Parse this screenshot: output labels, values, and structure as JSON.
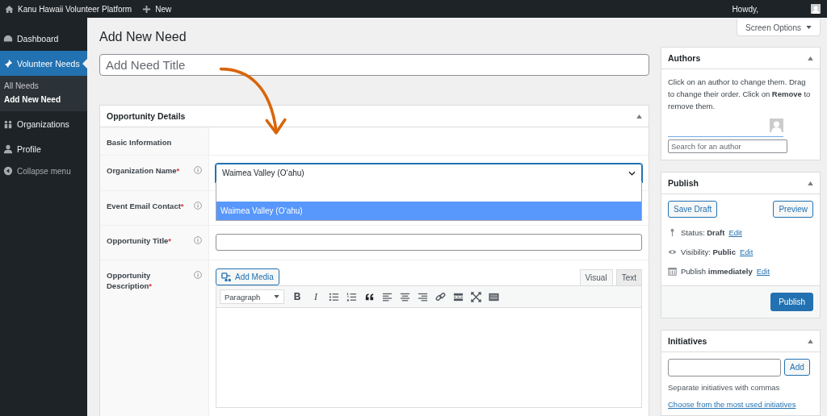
{
  "admin_bar": {
    "site_name": "Kanu Hawaii Volunteer Platform",
    "new_label": "New",
    "greeting": "Howdy,"
  },
  "sidebar": {
    "items": [
      {
        "label": "Dashboard",
        "selected": false
      },
      {
        "label": "Volunteer Needs",
        "selected": true,
        "children": [
          {
            "label": "All Needs",
            "selected": false
          },
          {
            "label": "Add New Need",
            "selected": true
          }
        ]
      },
      {
        "label": "Organizations",
        "selected": false
      },
      {
        "label": "Profile",
        "selected": false
      },
      {
        "label": "Collapse menu",
        "kind": "toggle",
        "selected": false
      }
    ]
  },
  "required_mark": "*",
  "screen_options": "Screen Options",
  "page_title": "Add New Need",
  "title_field": {
    "placeholder": "Add Need Title"
  },
  "details": {
    "title": "Opportunity Details",
    "rows": [
      {
        "kind": "section",
        "label": "Basic Information",
        "required": false
      },
      {
        "kind": "select",
        "label": "Organization Name",
        "required": true,
        "value": "Waimea Valley (O‘ahu)",
        "expanded": true,
        "options": [
          {
            "label": "Waimea Valley (O‘ahu)",
            "selected": true
          }
        ]
      },
      {
        "kind": "hidden",
        "label": "Event Email Contact",
        "required": true
      },
      {
        "kind": "text",
        "label": "Opportunity Title",
        "required": true
      },
      {
        "kind": "editor",
        "label": "Opportunity Description",
        "required": true,
        "add_media": "Add Media",
        "tabs": [
          {
            "label": "Visual",
            "selected": true
          },
          {
            "label": "Text",
            "selected": false
          }
        ],
        "format": "Paragraph",
        "bold": "B",
        "italic": "I"
      }
    ]
  },
  "authors": {
    "title": "Authors",
    "help": "Click on an author to change them. Drag to change their order. Click on **Remove** to remove them.",
    "search": {
      "placeholder": "Search for an author"
    }
  },
  "publish": {
    "title": "Publish",
    "save_draft": "Save Draft",
    "preview": "Preview",
    "status": "Status: **Draft**",
    "visibility": "Visibility: **Public**",
    "schedule": "Publish **immediately**",
    "edit_links": [
      "Edit",
      "Edit",
      "Edit"
    ],
    "publish_button": "Publish"
  },
  "initiatives": {
    "title": "Initiatives",
    "add": "Add",
    "hint": "Separate initiatives with commas",
    "choose_link": "Choose from the most used initiatives"
  }
}
